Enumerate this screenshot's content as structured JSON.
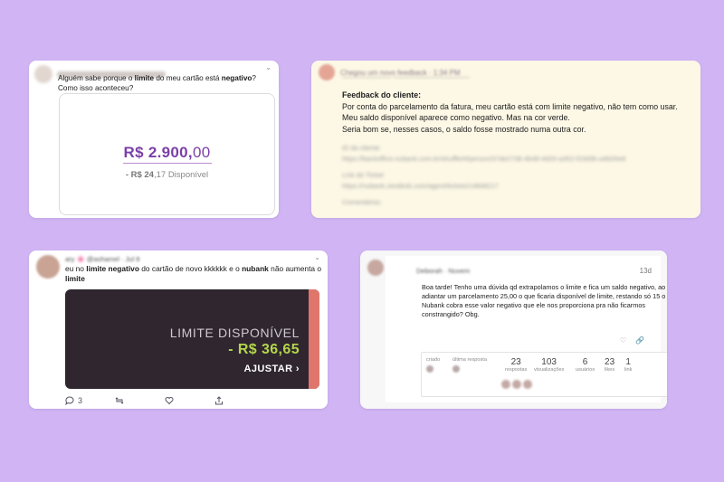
{
  "card1": {
    "tweet_pre": "Alguém sabe porque o ",
    "tweet_b1": "limite",
    "tweet_mid": " do meu cartão está ",
    "tweet_b2": "negativo",
    "tweet_post": "? Como isso aconteceu?",
    "amount_main": "R$ 2.900,",
    "amount_cents": "00",
    "disp_neg": "- R$ 24",
    "disp_rest": ",17 Disponível"
  },
  "card2": {
    "feedback_title": "Feedback do cliente:",
    "line1": "Por conta do parcelamento da fatura, meu cartão está com limite negativo, não tem como usar.",
    "line2": "Meu saldo disponível aparece como negativo. Mas na cor verde.",
    "line3": "Seria bom se, nesses casos, o saldo fosse mostrado numa outra cor."
  },
  "card3": {
    "tweet_pre": "eu no ",
    "tweet_b1": "limite negativo",
    "tweet_mid": " do cartão de novo kkkkkk e o ",
    "tweet_b2": "nubank",
    "tweet_mid2": "  não aumenta o ",
    "tweet_b3": "limite",
    "dark_label": "LIMITE DISPONÍVEL",
    "dark_value": "- R$ 36,65",
    "dark_action": "AJUSTAR ›",
    "reply_count": "3"
  },
  "card4": {
    "date": "13d",
    "text": "Boa tarde! Tenho uma dúvida qd extrapolamos o limite e fica um saldo negativo, ao adiantar um parcelamento 25,00 o que ficaria disponível de limite, restando só 15 o Nubank cobra esse valor negativo que ele nos proporciona pra não ficarmos constrangido? Obg.",
    "created_label": "criado",
    "last_reply_label": "última resposta",
    "stats": [
      {
        "n": "23",
        "l": "respostas"
      },
      {
        "n": "103",
        "l": "visualizações"
      },
      {
        "n": "6",
        "l": "usuários"
      },
      {
        "n": "23",
        "l": "likes"
      },
      {
        "n": "1",
        "l": "link"
      }
    ]
  }
}
